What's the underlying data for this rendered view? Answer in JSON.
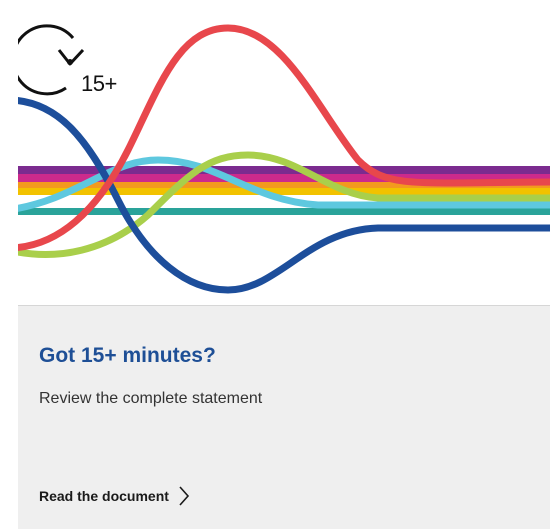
{
  "badge": {
    "icon": "clock-icon",
    "label": "15+"
  },
  "card": {
    "title": "Got 15+ minutes?",
    "subtitle": "Review the complete statement",
    "link_label": "Read the document",
    "link_icon": "chevron-right-icon"
  },
  "colors": {
    "title": "#1e4f96",
    "band_purple": "#7b2b8f",
    "band_magenta": "#cc2a8c",
    "band_yellow": "#f2c200",
    "band_orange": "#f39a1e",
    "band_teal": "#2aa39a",
    "band_cyan": "#5ec8df",
    "band_blue": "#1d4e9b",
    "line_red": "#e8474c",
    "line_green": "#a9cf4b",
    "panel_bg": "#efefef"
  }
}
